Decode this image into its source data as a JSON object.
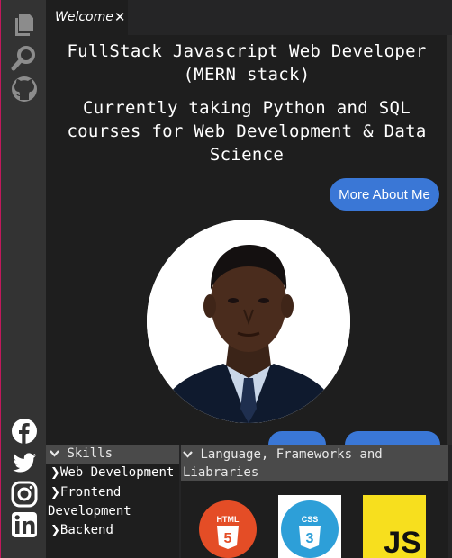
{
  "tab": {
    "label": "Welcome",
    "close": "✕"
  },
  "hero": {
    "title": "FullStack Javascript Web Developer (MERN stack)",
    "subtitle": "Currently taking Python and SQL courses for Web Development & Data Science",
    "button_label": "More About Me"
  },
  "skills": {
    "header": "Skills",
    "items": [
      "Web Development",
      "Frontend Development",
      "Backend"
    ]
  },
  "languages": {
    "header": "Language, Frameworks and Liabraries",
    "logos": [
      {
        "text": "HTML",
        "badge": "5",
        "color": "#e44d26"
      },
      {
        "text": "CSS",
        "badge": "3",
        "color": "#2d9fd8"
      },
      {
        "text": "JS",
        "color": "#f7df1e"
      }
    ]
  },
  "icons": {
    "activity": [
      "files-icon",
      "search-icon",
      "github-icon"
    ],
    "social": [
      "facebook-icon",
      "twitter-icon",
      "instagram-icon",
      "linkedin-icon"
    ]
  },
  "colors": {
    "accent": "#3a77d6",
    "sidebar": "#333333",
    "editor_bg": "#1e1e1e",
    "border": "#c2185b"
  }
}
